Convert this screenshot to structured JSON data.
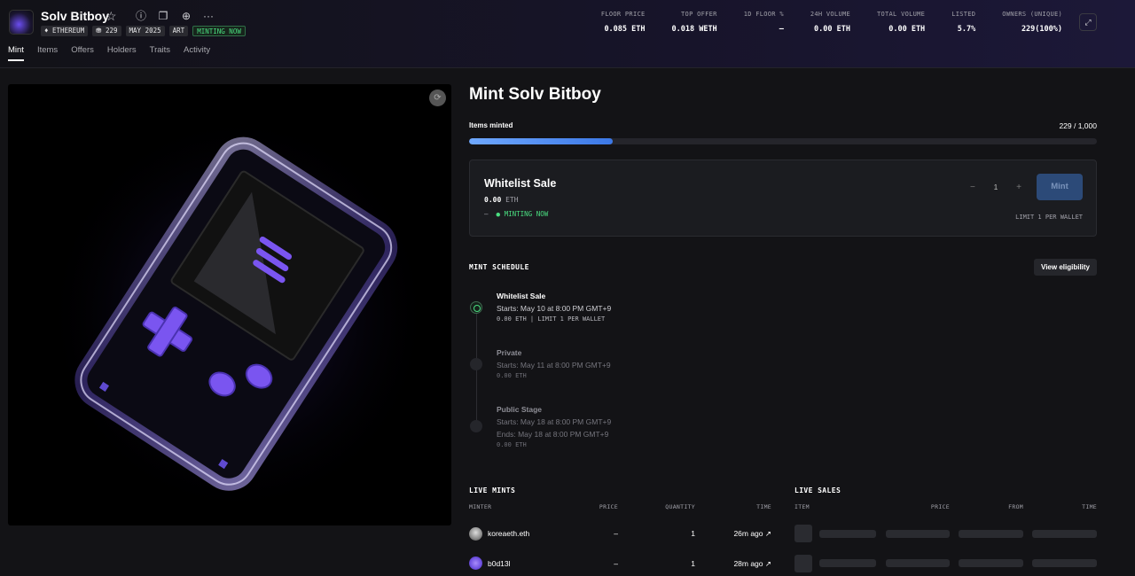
{
  "header": {
    "title": "Solv Bitboy",
    "tags": [
      "♦ ETHEREUM",
      "⛃ 229",
      "MAY 2025",
      "ART"
    ],
    "status_tag": "MINTING NOW",
    "tabs": [
      "Mint",
      "Items",
      "Offers",
      "Holders",
      "Traits",
      "Activity"
    ],
    "active_tab": "Mint"
  },
  "stats": [
    {
      "label": "FLOOR PRICE",
      "value": "0.085 ETH"
    },
    {
      "label": "TOP OFFER",
      "value": "0.018 WETH"
    },
    {
      "label": "1D FLOOR %",
      "value": "—"
    },
    {
      "label": "24H VOLUME",
      "value": "0.00 ETH"
    },
    {
      "label": "TOTAL VOLUME",
      "value": "0.00 ETH"
    },
    {
      "label": "LISTED",
      "value": "5.7%"
    },
    {
      "label": "OWNERS (UNIQUE)",
      "value": "229(100%)"
    }
  ],
  "mint": {
    "title": "Mint Solv Bitboy",
    "items_minted_label": "Items minted",
    "items_minted_value": "229 / 1,000",
    "progress_fraction": 0.229,
    "sale": {
      "title": "Whitelist Sale",
      "price": "0.00",
      "price_unit": "ETH",
      "status_prefix": "—",
      "status": "● MINTING NOW",
      "quantity": "1",
      "minus": "−",
      "plus": "+",
      "mint_button": "Mint",
      "limit": "LIMIT 1 PER WALLET"
    },
    "schedule_title": "MINT SCHEDULE",
    "eligibility_button": "View eligibility",
    "stages": [
      {
        "name": "Whitelist Sale",
        "line1": "Starts: May 10 at 8:00 PM GMT+9",
        "line2": "",
        "meta": "0.00 ETH | LIMIT 1 PER WALLET"
      },
      {
        "name": "Private",
        "line1": "Starts: May 11 at 8:00 PM GMT+9",
        "line2": "",
        "meta": "0.00 ETH"
      },
      {
        "name": "Public Stage",
        "line1": "Starts: May 18 at 8:00 PM GMT+9",
        "line2": "Ends: May 18 at 8:00 PM GMT+9",
        "meta": "0.00 ETH"
      }
    ]
  },
  "live_mints": {
    "title": "LIVE MINTS",
    "columns": [
      "MINTER",
      "PRICE",
      "QUANTITY",
      "TIME"
    ],
    "rows": [
      {
        "minter": "koreaeth.eth",
        "price": "–",
        "quantity": "1",
        "time": "26m ago ↗"
      },
      {
        "minter": "b0d13l",
        "price": "–",
        "quantity": "1",
        "time": "28m ago ↗"
      }
    ]
  },
  "live_sales": {
    "title": "LIVE SALES",
    "columns": [
      "ITEM",
      "PRICE",
      "FROM",
      "TIME"
    ]
  },
  "colors": {
    "accent": "#3c78e6",
    "success": "#4ade80",
    "nft_purple": "#7a55f0"
  }
}
